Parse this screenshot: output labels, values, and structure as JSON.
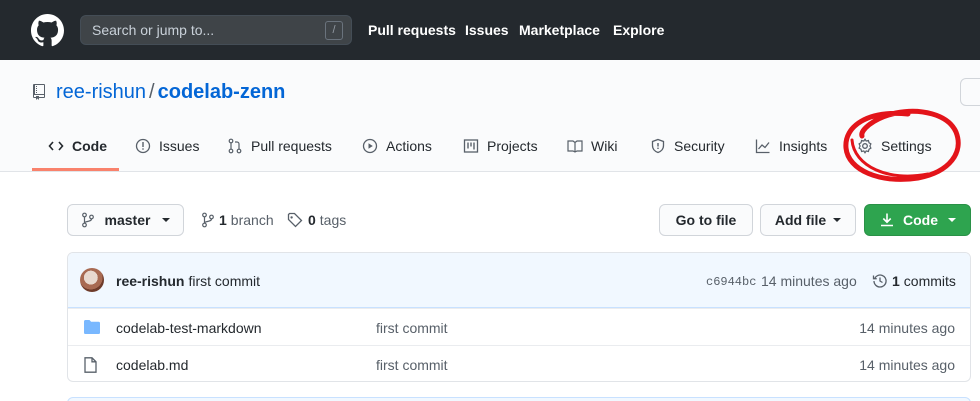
{
  "header": {
    "search_placeholder": "Search or jump to...",
    "search_shortcut": "/",
    "nav": [
      "Pull requests",
      "Issues",
      "Marketplace",
      "Explore"
    ]
  },
  "repo": {
    "owner": "ree-rishun",
    "separator": "/",
    "name": "codelab-zenn"
  },
  "tabs": [
    {
      "label": "Code",
      "icon": "code-icon",
      "selected": true
    },
    {
      "label": "Issues",
      "icon": "issue-icon"
    },
    {
      "label": "Pull requests",
      "icon": "pull-request-icon"
    },
    {
      "label": "Actions",
      "icon": "play-icon"
    },
    {
      "label": "Projects",
      "icon": "project-icon"
    },
    {
      "label": "Wiki",
      "icon": "book-icon"
    },
    {
      "label": "Security",
      "icon": "shield-icon"
    },
    {
      "label": "Insights",
      "icon": "graph-icon"
    },
    {
      "label": "Settings",
      "icon": "gear-icon"
    }
  ],
  "branch_bar": {
    "branch": "master",
    "branch_count": "1",
    "branch_label": "branch",
    "tag_count": "0",
    "tag_label": "tags",
    "go_to_file": "Go to file",
    "add_file": "Add file",
    "code": "Code"
  },
  "latest_commit": {
    "author": "ree-rishun",
    "message": "first commit",
    "sha": "c6944bc",
    "time": "14 minutes ago",
    "commit_count": "1",
    "commit_label": "commits"
  },
  "files": [
    {
      "type": "folder",
      "name": "codelab-test-markdown",
      "message": "first commit",
      "age": "14 minutes ago"
    },
    {
      "type": "file",
      "name": "codelab.md",
      "message": "first commit",
      "age": "14 minutes ago"
    }
  ],
  "colors": {
    "header_bg": "#24292e",
    "link_blue": "#0366d6",
    "green_button": "#2ea44f",
    "tab_underline": "#f9826c",
    "annotation_red": "#e3141a"
  }
}
